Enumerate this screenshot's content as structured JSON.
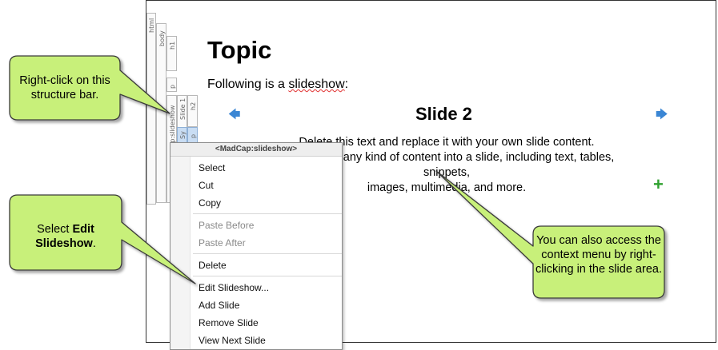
{
  "structure_bar": {
    "labels": [
      "html",
      "body",
      "h1",
      "p",
      "MadCap:slideshow",
      "Slide 1",
      "h2",
      "Sy",
      "p",
      "p"
    ]
  },
  "document": {
    "title": "Topic",
    "intro_before": "Following is a ",
    "intro_misspelled": "slideshow",
    "intro_after": ":",
    "slide": {
      "title": "Slide 2",
      "prev_icon": "arrow-left-icon",
      "next_icon": "arrow-right-icon",
      "line1": "Delete this text and replace it with your own slide content.",
      "line2": "You can put any kind of content into a slide, including text, tables, snippets,",
      "line3": "images, multimedia, and more.",
      "add_icon": "plus-icon"
    }
  },
  "context_menu": {
    "header": "<MadCap:slideshow>",
    "items": [
      {
        "label": "Select",
        "enabled": true
      },
      {
        "label": "Cut",
        "enabled": true
      },
      {
        "label": "Copy",
        "enabled": true
      },
      {
        "label": "Paste Before",
        "enabled": false
      },
      {
        "label": "Paste After",
        "enabled": false
      },
      {
        "label": "Delete",
        "enabled": true
      },
      {
        "label": "Edit Slideshow...",
        "enabled": true
      },
      {
        "label": "Add Slide",
        "enabled": true
      },
      {
        "label": "Remove Slide",
        "enabled": true
      },
      {
        "label": "View Next Slide",
        "enabled": true
      }
    ]
  },
  "callouts": {
    "right_click": "Right-click on this structure bar.",
    "select_prefix": "Select ",
    "select_bold": "Edit Slideshow",
    "select_suffix": ".",
    "context_tip": "You can also access the context menu by right-clicking in the slide area."
  },
  "colors": {
    "callout_fill": "#c8f07a",
    "callout_border": "#3a3a3a",
    "arrow": "#3a86d4",
    "plus": "#2fa12f"
  }
}
